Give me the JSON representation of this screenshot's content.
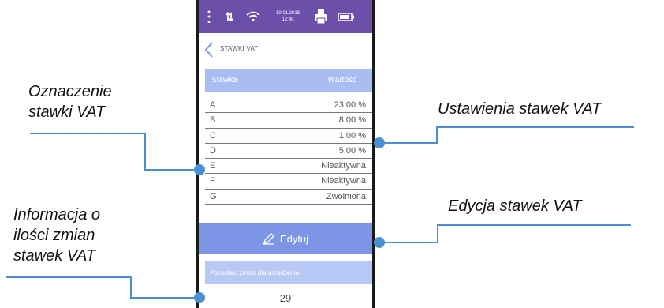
{
  "status_bar": {
    "date": "10.01.2018",
    "time": "12:45"
  },
  "screen": {
    "title": "STAWKI VAT",
    "table_header": {
      "col1": "Stawka",
      "col2": "Wartość"
    },
    "rows": [
      {
        "rate": "A",
        "value": "23.00 %"
      },
      {
        "rate": "B",
        "value": "8.00 %"
      },
      {
        "rate": "C",
        "value": "1.00 %"
      },
      {
        "rate": "D",
        "value": "5.00 %"
      },
      {
        "rate": "E",
        "value": "Nieaktywna"
      },
      {
        "rate": "F",
        "value": "Nieaktywna"
      },
      {
        "rate": "G",
        "value": "Zwolniona"
      }
    ],
    "edit_label": "Edytuj",
    "remaining_label": "Pozostało zmian dla urządzenia",
    "remaining_count": "29"
  },
  "annotations": {
    "rate_marker_line1": "Oznaczenie",
    "rate_marker_line2": "stawki VAT",
    "settings": "Ustawienia stawek VAT",
    "edit": "Edycja stawek VAT",
    "info_line1": "Informacja o",
    "info_line2": "ilości zmian",
    "info_line3": "stawek VAT"
  },
  "colors": {
    "status_bar": "#6b4fa8",
    "table_header": "#aabdf3",
    "edit_button": "#7c96e5",
    "info_box": "#b8c8f4",
    "annotation_line": "#4a8fd0"
  }
}
